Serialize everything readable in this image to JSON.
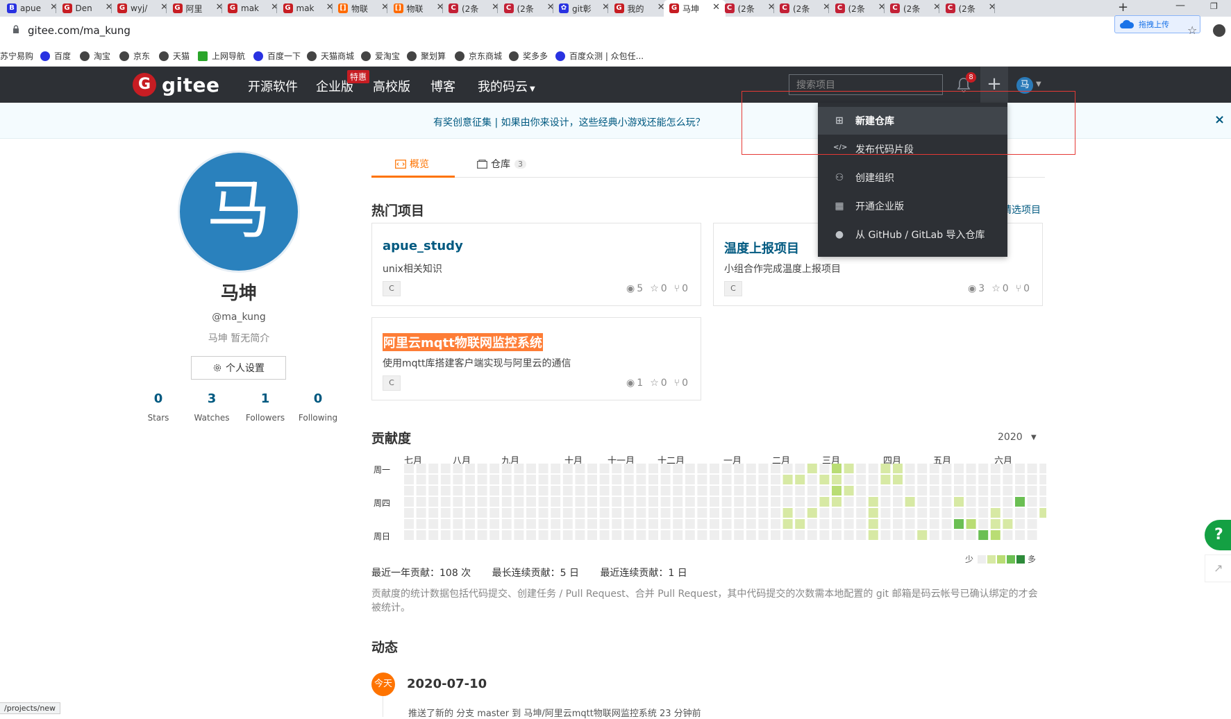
{
  "browser": {
    "tabs": [
      {
        "title": "apue",
        "icon": "b-icon",
        "color": "#2932e1"
      },
      {
        "title": "Den",
        "icon": "gitee-icon",
        "color": "#c71d23"
      },
      {
        "title": "wyj/",
        "icon": "gitee-icon",
        "color": "#c71d23"
      },
      {
        "title": "阿里",
        "icon": "gitee-icon",
        "color": "#c71d23"
      },
      {
        "title": "mak",
        "icon": "gitee-icon",
        "color": "#c71d23"
      },
      {
        "title": "mak",
        "icon": "gitee-icon",
        "color": "#c71d23"
      },
      {
        "title": "物联",
        "icon": "aliyun-icon",
        "color": "#ff6a00"
      },
      {
        "title": "物联",
        "icon": "aliyun-icon",
        "color": "#ff6a00"
      },
      {
        "title": "(2条",
        "icon": "csdn-icon",
        "color": "#c32136"
      },
      {
        "title": "(2条",
        "icon": "csdn-icon",
        "color": "#c32136"
      },
      {
        "title": "git彰",
        "icon": "baidu-icon",
        "color": "#2932e1"
      },
      {
        "title": "我的",
        "icon": "gitee-icon",
        "color": "#c71d23"
      },
      {
        "title": "马坤",
        "icon": "gitee-icon",
        "color": "#c71d23",
        "active": true
      },
      {
        "title": "(2条",
        "icon": "csdn-icon",
        "color": "#c32136"
      },
      {
        "title": "(2条",
        "icon": "csdn-icon",
        "color": "#c32136"
      },
      {
        "title": "(2条",
        "icon": "csdn-icon",
        "color": "#c32136"
      },
      {
        "title": "(2条",
        "icon": "csdn-icon",
        "color": "#c32136"
      },
      {
        "title": "(2条",
        "icon": "csdn-icon",
        "color": "#c32136"
      }
    ],
    "new_tab": "+",
    "minimize": "—",
    "restore": "❐",
    "url": "gitee.com/ma_kung",
    "upload_label": "拖拽上传",
    "status_url": "/projects/new",
    "bookmarks": [
      {
        "label": "苏宁易购",
        "icon": "none"
      },
      {
        "label": "百度",
        "icon": "baidu-icon"
      },
      {
        "label": "淘宝",
        "icon": "globe-icon"
      },
      {
        "label": "京东",
        "icon": "globe-icon"
      },
      {
        "label": "天猫",
        "icon": "globe-icon"
      },
      {
        "label": "上网导航",
        "icon": "nav-icon"
      },
      {
        "label": "百度一下",
        "icon": "baidu-icon"
      },
      {
        "label": "天猫商城",
        "icon": "globe-icon"
      },
      {
        "label": "爱淘宝",
        "icon": "globe-icon"
      },
      {
        "label": "聚划算",
        "icon": "globe-icon"
      },
      {
        "label": "京东商城",
        "icon": "globe-icon"
      },
      {
        "label": "奖多多",
        "icon": "globe-icon"
      },
      {
        "label": "百度众测 | 众包任...",
        "icon": "baidu-icon"
      }
    ]
  },
  "header": {
    "logo_text": "gitee",
    "logo_mark": "G",
    "nav": [
      "开源软件",
      "企业版",
      "高校版",
      "博客",
      "我的码云"
    ],
    "nav_badge": "特惠",
    "search_placeholder": "搜索项目",
    "notification_count": "8",
    "plus": "+",
    "avatar_char": "马"
  },
  "announcement": {
    "text": "有奖创意征集 | 如果由你来设计，这些经典小游戏还能怎么玩？",
    "close": "×"
  },
  "create_menu": {
    "items": [
      {
        "label": "新建仓库",
        "icon": "plus-square-icon",
        "active": true
      },
      {
        "label": "发布代码片段",
        "icon": "code-icon"
      },
      {
        "label": "创建组织",
        "icon": "group-icon"
      },
      {
        "label": "开通企业版",
        "icon": "building-icon"
      },
      {
        "label": "从 GitHub / GitLab 导入仓库",
        "icon": "github-icon"
      }
    ]
  },
  "profile": {
    "avatar_char": "马",
    "name": "马坤",
    "username": "@ma_kung",
    "bio": "马坤 暂无简介",
    "settings_label": "个人设置",
    "stats": [
      {
        "value": "0",
        "label": "Stars"
      },
      {
        "value": "3",
        "label": "Watches"
      },
      {
        "value": "1",
        "label": "Followers"
      },
      {
        "value": "0",
        "label": "Following"
      }
    ]
  },
  "tabs": {
    "overview": "概览",
    "repos": "仓库",
    "repo_count": "3"
  },
  "hot_projects": {
    "title": "热门项目",
    "pick_label": "精选项目",
    "cards": [
      {
        "name": "apue_study",
        "desc": "unix相关知识",
        "lang": "C",
        "watch": "5",
        "star": "0",
        "fork": "0",
        "highlight": false
      },
      {
        "name": "温度上报项目",
        "desc": "小组合作完成温度上报项目",
        "lang": "C",
        "watch": "3",
        "star": "0",
        "fork": "0",
        "highlight": false
      },
      {
        "name": "阿里云mqtt物联网监控系统",
        "desc": "使用mqtt库搭建客户端实现与阿里云的通信",
        "lang": "C",
        "watch": "1",
        "star": "0",
        "fork": "0",
        "highlight": true
      }
    ]
  },
  "contribution": {
    "title": "贡献度",
    "year": "2020",
    "months": [
      "七月",
      "八月",
      "九月",
      "十月",
      "十一月",
      "十二月",
      "一月",
      "二月",
      "三月",
      "四月",
      "五月",
      "六月"
    ],
    "day_labels": [
      "周一",
      "周四",
      "周日"
    ],
    "legend_less": "少",
    "legend_more": "多",
    "legend_colors": [
      "#eeeeee",
      "#d7e9a4",
      "#b9dd74",
      "#6bbf53",
      "#2d8a3a"
    ],
    "summary": [
      "最近一年贡献：108 次",
      "最长连续贡献：5 日",
      "最近连续贡献：1 日"
    ],
    "note": "贡献度的统计数据包括代码提交、创建任务 / Pull Request、合并 Pull Request，其中代码提交的次数需本地配置的 git 邮箱是码云帐号已确认绑定的才会被统计。"
  },
  "activity": {
    "title": "动态",
    "today": "今天",
    "date": "2020-07-10",
    "event": "推送了新的 分支 master 到 马坤/阿里云mqtt物联网监控系统 23 分钟前"
  },
  "floating": {
    "help": "?",
    "share": "↗"
  }
}
